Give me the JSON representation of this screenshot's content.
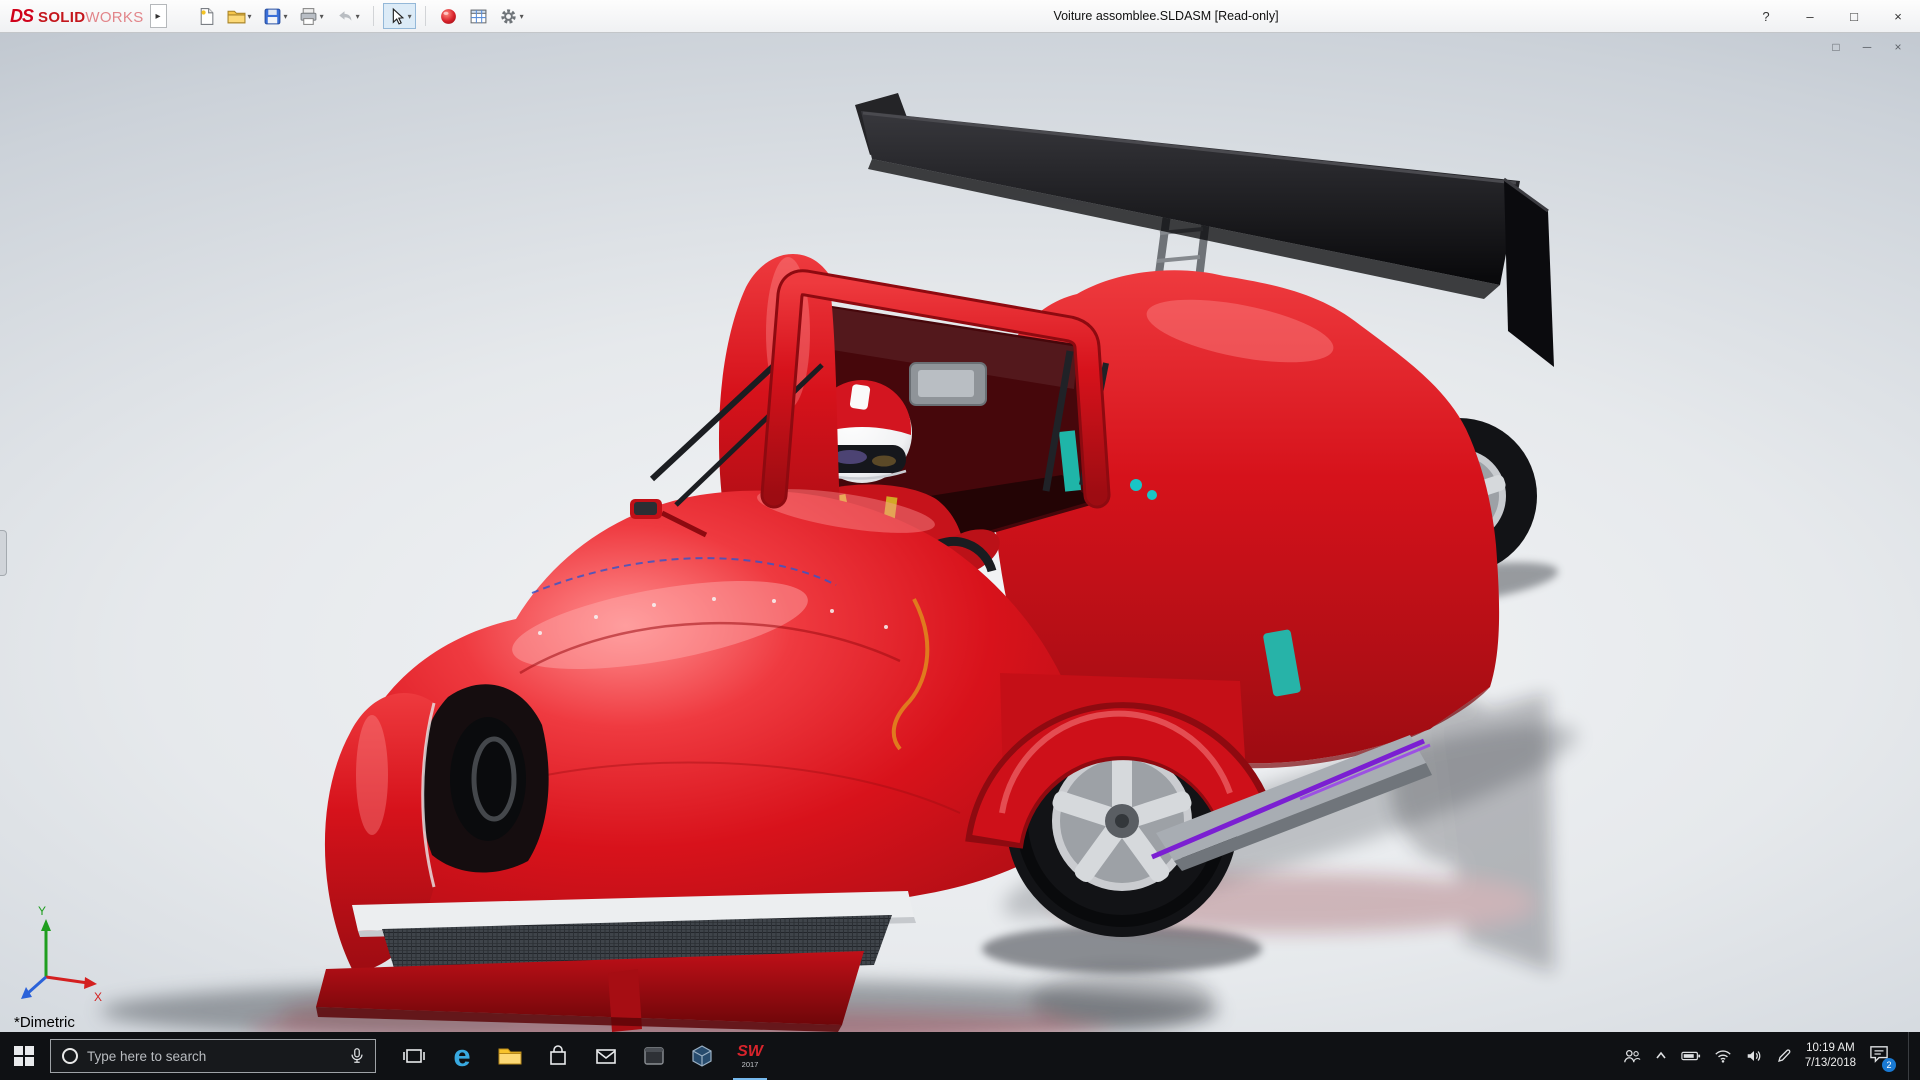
{
  "titlebar": {
    "brand": {
      "ds": "DS",
      "solid": "SOLID",
      "works": "WORKS"
    },
    "flyout_arrow": "▸",
    "title": "Voiture assomblee.SLDASM [Read-only]",
    "controls": {
      "help": "?",
      "minimize": "–",
      "maximize": "□",
      "close": "×"
    }
  },
  "toolbar": {
    "dropdown_caret": "▾"
  },
  "doc_window_controls": {
    "restore": "□",
    "minimize": "─",
    "close": "×"
  },
  "viewport": {
    "orientation_label": "*Dimetric",
    "triad": {
      "x_label": "X",
      "y_label": "Y"
    }
  },
  "taskbar": {
    "search": {
      "placeholder": "Type here to search"
    },
    "edge_letter": "e",
    "solidworks": {
      "label": "SW",
      "year": "2017"
    },
    "clock": {
      "time": "10:19 AM",
      "date": "7/13/2018"
    },
    "notification_badge": "2"
  },
  "colors": {
    "body_red": "#d6121b",
    "wing_black": "#141416",
    "accent_teal": "#27b3a8",
    "accent_purple": "#7b1fd2",
    "taskbar_bg": "#0f1114"
  }
}
